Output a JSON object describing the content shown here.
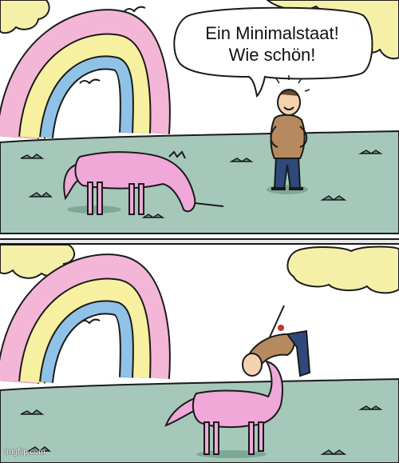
{
  "speech_bubble": {
    "line1": "Ein Minimalstaat!",
    "line2": "Wie schön!"
  },
  "watermark": "imgflip.com",
  "colors": {
    "ground": "#a6c8ba",
    "cloud": "#f5f0a8",
    "unicorn": "#efa8d8",
    "shirt": "#b68a5e",
    "pants": "#2f4a7a",
    "rainbow_pink": "#f3b6d6",
    "rainbow_yellow": "#f6f0a0",
    "rainbow_blue": "#8fc2e6"
  }
}
